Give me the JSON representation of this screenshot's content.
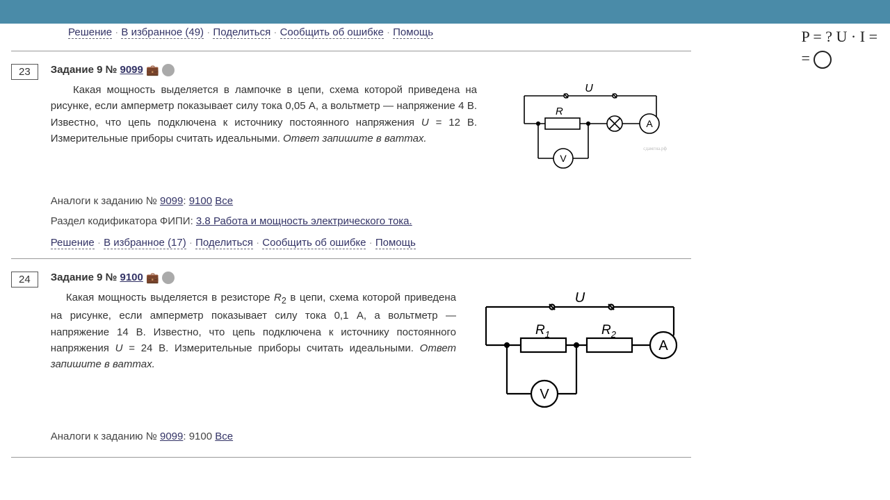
{
  "topFragment": {
    "resh": "Решение",
    "fav": "В избранное (49)",
    "share": "Поделиться",
    "report": "Сообщить об ошибке",
    "help": "Помощь"
  },
  "task23": {
    "num": "23",
    "titlePrefix": "Задание 9 № ",
    "titleId": "9099",
    "body1": "Какая мощность выделяется в лампочке в цепи, схема которой приведена на рисунке, если амперметр показывает силу тока 0,05 А, а вольтметр — напряжение 4 В. Известно, что цепь подключена к источнику постоянного напряжения ",
    "uEq": "U",
    "uVal": " = 12 В. Измерительные приборы считать идеальными. ",
    "bodyItalic": "Ответ запишите в ваттах.",
    "analogsLabel": "Аналоги к заданию № ",
    "analog1": "9099",
    "analogSep": ": ",
    "analog2": "9100",
    "analogAll": "Все",
    "codLabel": "Раздел кодификатора ФИПИ: ",
    "codLink": "3.8 Работа и мощность электрического тока.",
    "act": {
      "resh": "Решение",
      "fav": "В избранное (17)",
      "share": "Поделиться",
      "report": "Сообщить об ошибке",
      "help": "Помощь"
    },
    "svg": {
      "U": "U",
      "R": "R",
      "A": "A",
      "V": "V",
      "wm": "сдамгиа.рф"
    }
  },
  "task24": {
    "num": "24",
    "titlePrefix": "Задание 9 № ",
    "titleId": "9100",
    "body1": "Какая мощность выделяется в резисторе ",
    "r2": "R",
    "r2sub": "2",
    "body2": " в цепи, схема которой приведена на рисунке, если амперметр показывает силу тока 0,1 А, а вольтметр — напряжение 14 В. Известно, что цепь подключена к источнику постоянного напряжения ",
    "uEq": "U",
    "uVal": " = 24 В. Измерительные приборы считать идеальными. ",
    "bodyItalic": "Ответ запишите в ваттах.",
    "analogsLabel": "Аналоги к заданию № ",
    "analog1": "9099",
    "analogSep": ": 9100 ",
    "analogAll": "Все",
    "svg": {
      "U": "U",
      "R1": "R",
      "R1sub": "1",
      "R2": "R",
      "R2sub": "2",
      "A": "A",
      "V": "V"
    }
  },
  "annot": {
    "l1": "P = ? U · I =",
    "eq": "="
  }
}
